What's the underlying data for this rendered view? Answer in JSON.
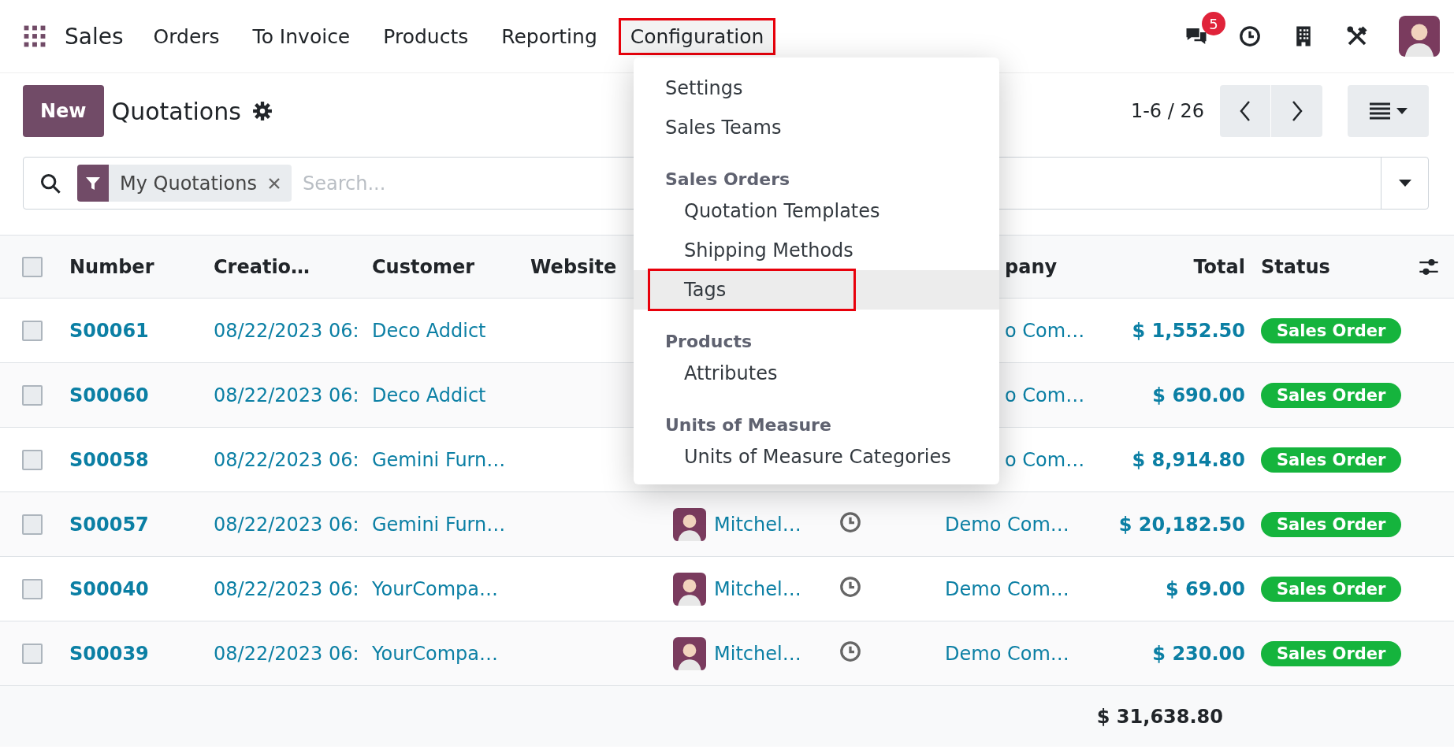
{
  "topbar": {
    "app": "Sales",
    "menu": [
      {
        "label": "Orders",
        "open": false,
        "annotated": false
      },
      {
        "label": "To Invoice",
        "open": false,
        "annotated": false
      },
      {
        "label": "Products",
        "open": false,
        "annotated": false
      },
      {
        "label": "Reporting",
        "open": false,
        "annotated": false
      },
      {
        "label": "Configuration",
        "open": true,
        "annotated": true
      }
    ],
    "chat_badge": "5"
  },
  "dropdown": {
    "sections": [
      {
        "items": [
          {
            "label": "Settings",
            "hovered": false,
            "annotated": false
          },
          {
            "label": "Sales Teams",
            "hovered": false,
            "annotated": false
          }
        ]
      },
      {
        "title": "Sales Orders",
        "items": [
          {
            "label": "Quotation Templates",
            "hovered": false,
            "annotated": false
          },
          {
            "label": "Shipping Methods",
            "hovered": false,
            "annotated": false
          },
          {
            "label": "Tags",
            "hovered": true,
            "annotated": true
          }
        ]
      },
      {
        "title": "Products",
        "items": [
          {
            "label": "Attributes",
            "hovered": false,
            "annotated": false
          }
        ]
      },
      {
        "title": "Units of Measure",
        "items": [
          {
            "label": "Units of Measure Categories",
            "hovered": false,
            "annotated": false
          }
        ]
      }
    ]
  },
  "control_panel": {
    "new_button": "New",
    "title": "Quotations",
    "pager": "1-6 / 26"
  },
  "search": {
    "facet": "My Quotations",
    "placeholder": "Search..."
  },
  "table": {
    "all_checked": false,
    "columns": {
      "number": "Number",
      "created": "Creatio…",
      "customer": "Customer",
      "website": "Website",
      "company": "pany",
      "total": "Total",
      "status": "Status"
    },
    "rows": [
      {
        "number": "S00061",
        "created": "08/22/2023 06:",
        "customer": "Deco Addict",
        "checked": false,
        "company": "o Com…",
        "total": "$ 1,552.50",
        "status": "Sales Order"
      },
      {
        "number": "S00060",
        "created": "08/22/2023 06:",
        "customer": "Deco Addict",
        "checked": false,
        "company": "o Com…",
        "total": "$ 690.00",
        "status": "Sales Order"
      },
      {
        "number": "S00058",
        "created": "08/22/2023 06:",
        "customer": "Gemini Furn…",
        "checked": false,
        "company": "o Com…",
        "total": "$ 8,914.80",
        "status": "Sales Order"
      },
      {
        "number": "S00057",
        "created": "08/22/2023 06:",
        "customer": "Gemini Furn…",
        "salesperson": "Mitchel…",
        "checked": false,
        "company": "Demo Com…",
        "total": "$ 20,182.50",
        "status": "Sales Order"
      },
      {
        "number": "S00040",
        "created": "08/22/2023 06:",
        "customer": "YourCompa…",
        "salesperson": "Mitchel…",
        "checked": false,
        "company": "Demo Com…",
        "total": "$ 69.00",
        "status": "Sales Order"
      },
      {
        "number": "S00039",
        "created": "08/22/2023 06:",
        "customer": "YourCompa…",
        "salesperson": "Mitchel…",
        "checked": false,
        "company": "Demo Com…",
        "total": "$ 230.00",
        "status": "Sales Order"
      }
    ],
    "sum_total": "$ 31,638.80"
  }
}
